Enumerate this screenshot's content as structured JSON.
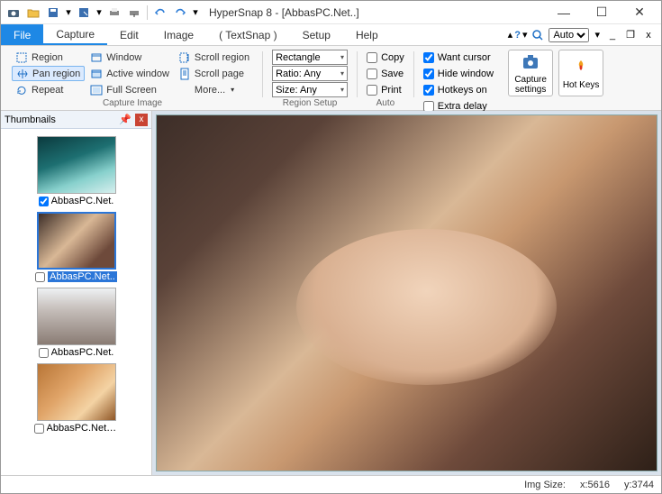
{
  "title": "HyperSnap 8 - [AbbasPC.Net..]",
  "qat_icons": [
    "camera-icon",
    "folder-open-icon",
    "save-icon",
    "caret-down-icon",
    "save-as-icon",
    "caret-down-icon",
    "print-icon",
    "print-down-icon",
    "undo-icon",
    "redo-icon",
    "caret-down-icon"
  ],
  "menus": {
    "file": "File",
    "capture": "Capture",
    "edit": "Edit",
    "image": "Image",
    "textsnap": "( TextSnap )",
    "setup": "Setup",
    "help": "Help"
  },
  "right_tools": {
    "help": "?",
    "zoom_label": "Auto",
    "minimize": "_",
    "restore": "❐",
    "close": "x"
  },
  "ribbon": {
    "capture_image": {
      "label": "Capture Image",
      "col1": [
        {
          "icon": "region-icon",
          "label": "Region"
        },
        {
          "icon": "pan-region-icon",
          "label": "Pan region",
          "selected": true
        },
        {
          "icon": "repeat-icon",
          "label": "Repeat"
        }
      ],
      "col2": [
        {
          "icon": "window-icon",
          "label": "Window"
        },
        {
          "icon": "active-window-icon",
          "label": "Active window"
        },
        {
          "icon": "full-screen-icon",
          "label": "Full Screen"
        }
      ],
      "col3": [
        {
          "icon": "scroll-region-icon",
          "label": "Scroll region"
        },
        {
          "icon": "scroll-page-icon",
          "label": "Scroll page"
        },
        {
          "icon": "more-icon",
          "label": "More...",
          "dropdown": true
        }
      ]
    },
    "region_setup": {
      "label": "Region Setup",
      "shape": "Rectangle",
      "ratio": "Ratio: Any",
      "size": "Size: Any"
    },
    "auto": {
      "label": "Auto",
      "options": [
        {
          "label": "Copy",
          "checked": false
        },
        {
          "label": "Save",
          "checked": false
        },
        {
          "label": "Print",
          "checked": false
        }
      ]
    },
    "options2": [
      {
        "label": "Want cursor",
        "checked": true
      },
      {
        "label": "Hide window",
        "checked": true
      },
      {
        "label": "Hotkeys on",
        "checked": true
      },
      {
        "label": "Extra delay",
        "checked": false
      }
    ],
    "buttons": [
      {
        "icon": "capture-settings-icon",
        "label": "Capture settings"
      },
      {
        "icon": "hot-keys-icon",
        "label": "Hot Keys"
      }
    ]
  },
  "thumbnails": {
    "title": "Thumbnails",
    "items": [
      {
        "name": "AbbasPC.Net.",
        "checked": true,
        "art": "art1"
      },
      {
        "name": "AbbasPC.Net..",
        "checked": false,
        "art": "art2",
        "selected": true
      },
      {
        "name": "AbbasPC.Net.",
        "checked": false,
        "art": "art3"
      },
      {
        "name": "AbbasPC.Net_...",
        "checked": false,
        "art": "art4"
      }
    ]
  },
  "status": {
    "imgsize_label": "Img Size:",
    "x": "x:5616",
    "y": "y:3744"
  }
}
